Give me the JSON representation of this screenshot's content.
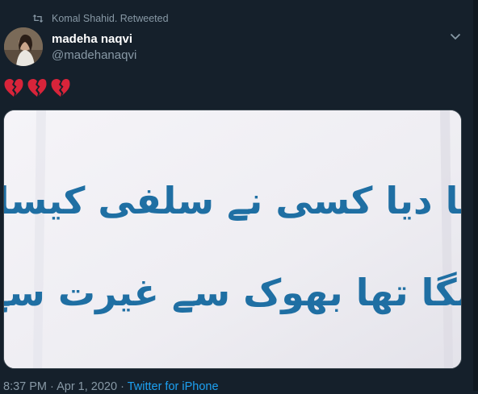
{
  "retweet": {
    "icon": "retweet-icon",
    "text": "Komal Shahid. Retweeted"
  },
  "author": {
    "display_name": "madeha naqvi",
    "handle": "@madehanaqvi",
    "avatar_icon": "avatar"
  },
  "tweet": {
    "emojis": [
      "broken-heart-icon",
      "broken-heart-icon",
      "broken-heart-icon"
    ],
    "image_text": {
      "line1": "راشن تھما دیا کسی نے سلفی کیساتھ ساتھ",
      "line2": "جو مرنے لگا تھا بھوک سے غیرت سے مر گیا"
    }
  },
  "meta": {
    "time": "8:37 PM",
    "separator": " · ",
    "date": "Apr 1, 2020",
    "source": "Twitter for iPhone"
  },
  "colors": {
    "background": "#15202b",
    "muted": "#8899a6",
    "accent": "#1da1f2",
    "ink": "#1f6fa3"
  }
}
